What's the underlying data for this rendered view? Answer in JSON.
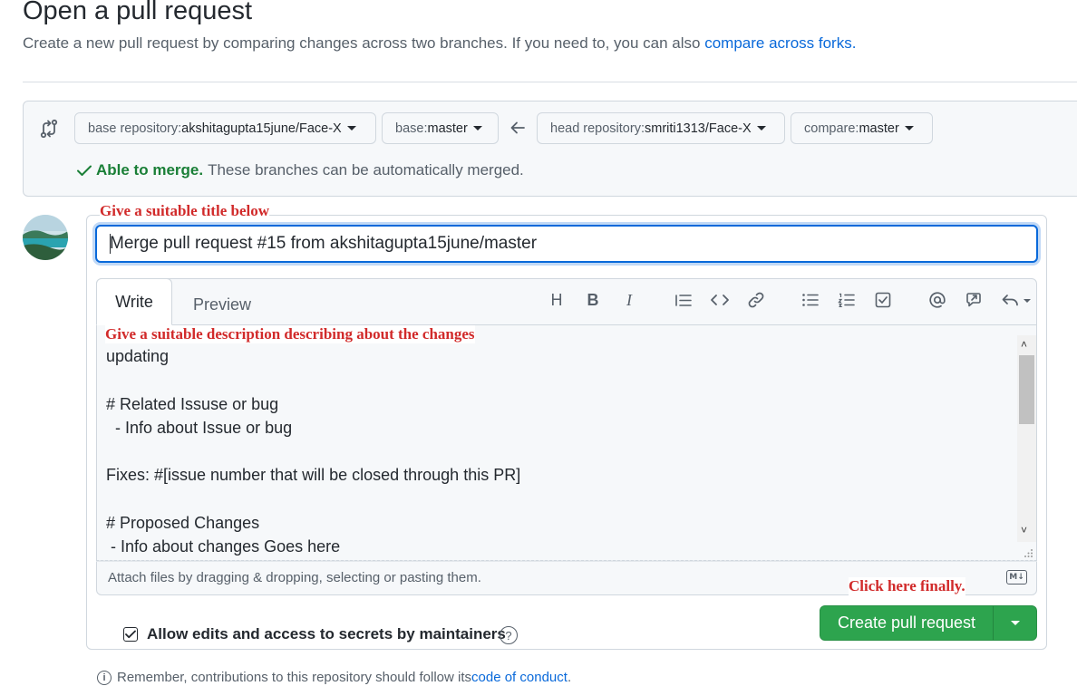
{
  "header": {
    "title": "Open a pull request",
    "subtitle": "Create a new pull request by comparing changes across two branches. If you need to, you can also ",
    "subtitle_link": "compare across forks."
  },
  "range": {
    "base_repo_label": "base repository: ",
    "base_repo_value": "akshitagupta15june/Face-X",
    "base_label": "base: ",
    "base_value": "master",
    "head_repo_label": "head repository: ",
    "head_repo_value": "smriti1313/Face-X",
    "compare_label": "compare: ",
    "compare_value": "master",
    "merge_status": "Able to merge.",
    "merge_text": "These branches can be automatically merged."
  },
  "annotations": {
    "title_hint": "Give a suitable title below",
    "description_hint": "Give a suitable description describing about the changes",
    "click_hint": "Click here finally."
  },
  "form": {
    "title_value": "Merge pull request #15 from akshitagupta15june/master",
    "tab_write": "Write",
    "tab_preview": "Preview",
    "body_text": "updating\n\n# Related Issuse or bug\n  - Info about Issue or bug\n\nFixes: #[issue number that will be closed through this PR]\n\n# Proposed Changes\n - Info about changes Goes here",
    "attach_text": "Attach files by dragging & dropping, selecting or pasting them.",
    "markdown_badge": "M↓",
    "allow_edits": "Allow edits and access to secrets by maintainers",
    "create_button": "Create pull request"
  },
  "toolbar": {
    "heading": "H",
    "bold": "B",
    "italic": "I"
  },
  "footer": {
    "text": "Remember, contributions to this repository should follow its ",
    "link": "code of conduct",
    "end": "."
  },
  "colors": {
    "accent": "#0969da",
    "success": "#1a7f37",
    "button_green": "#2da44e",
    "annotation_red": "#d12a2a"
  },
  "icons": [
    "compare-icon",
    "arrow-left-icon",
    "check-icon",
    "heading-icon",
    "bold-icon",
    "italic-icon",
    "quote-icon",
    "code-icon",
    "link-icon",
    "unordered-list-icon",
    "ordered-list-icon",
    "task-list-icon",
    "mention-icon",
    "reference-icon",
    "reply-icon",
    "help-icon",
    "info-icon",
    "markdown-icon"
  ]
}
